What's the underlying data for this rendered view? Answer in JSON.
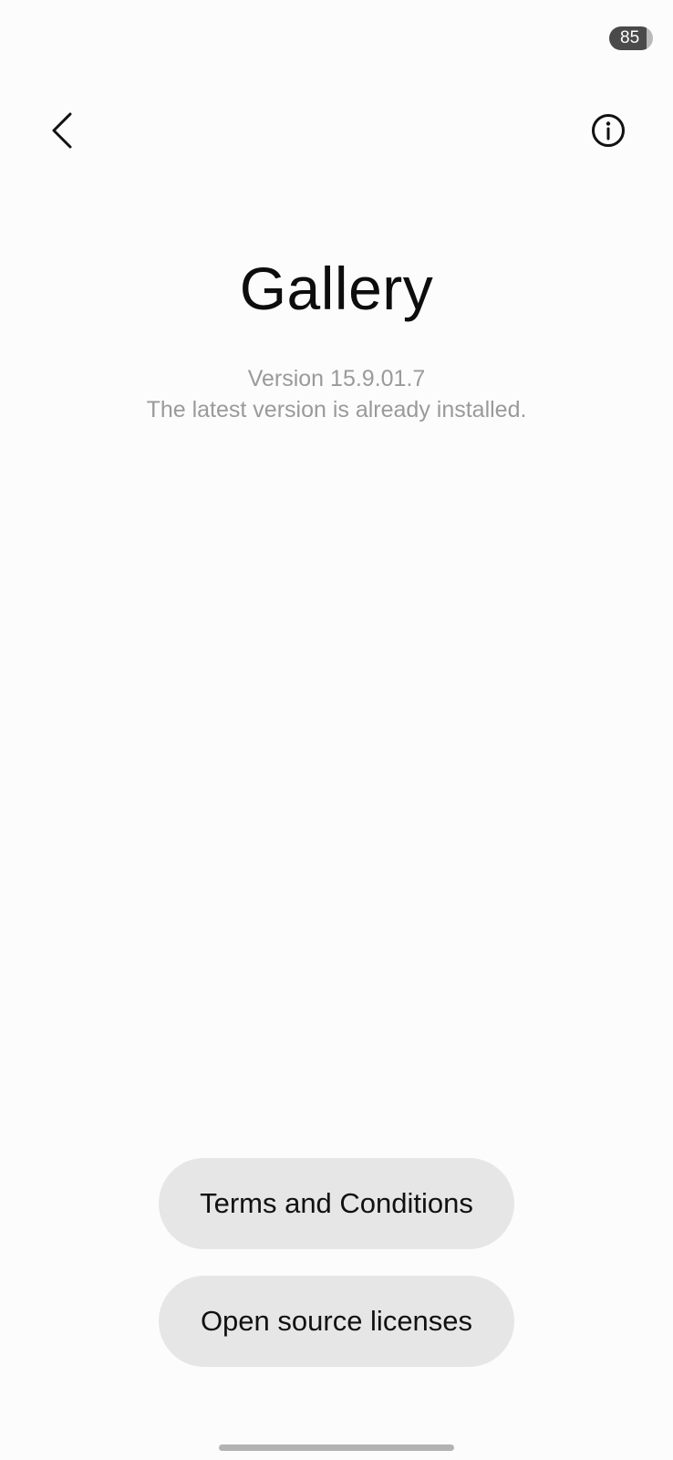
{
  "status_bar": {
    "battery_level": "85"
  },
  "header": {
    "back_icon": "chevron-left-icon",
    "info_icon": "info-circle-icon"
  },
  "app": {
    "title": "Gallery",
    "version": "Version 15.9.01.7",
    "update_status": "The latest version is already installed."
  },
  "actions": {
    "terms_label": "Terms and Conditions",
    "licenses_label": "Open source licenses"
  },
  "colors": {
    "background": "#fdfcfd",
    "button_background": "#e7e6e7",
    "secondary_text": "#9a9a9a"
  }
}
